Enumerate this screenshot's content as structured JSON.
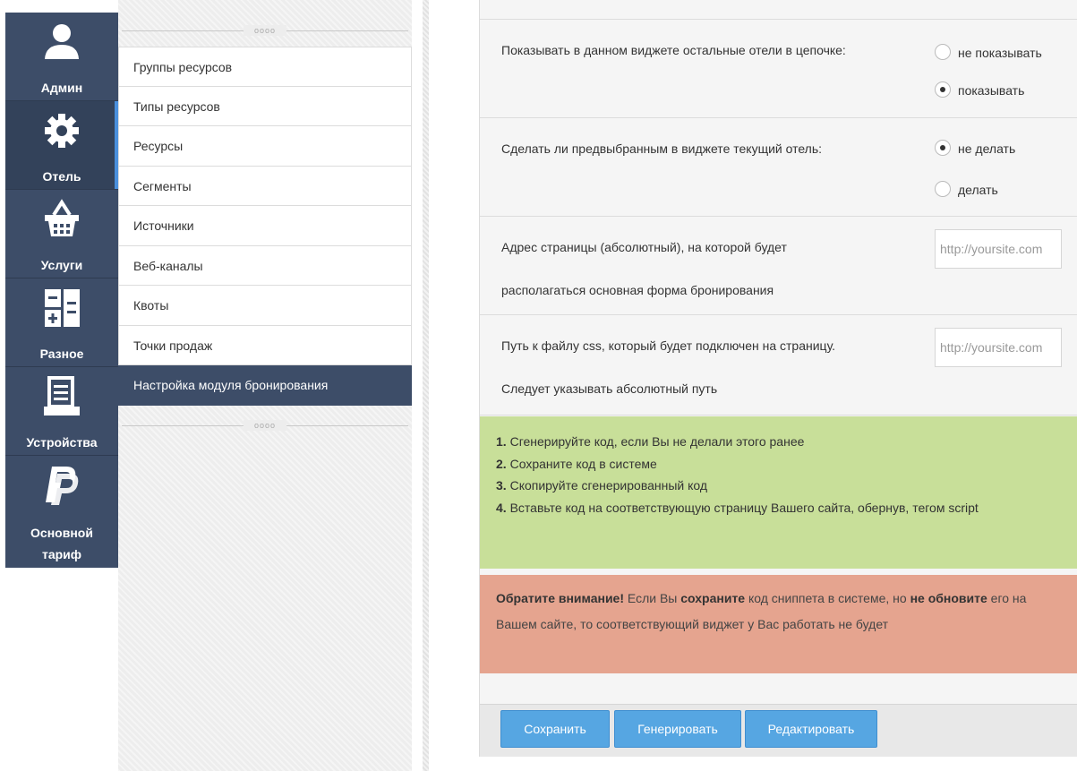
{
  "rail": {
    "items": [
      {
        "label": "Админ",
        "icon": "user-icon"
      },
      {
        "label": "Отель",
        "icon": "gear-icon",
        "active": true
      },
      {
        "label": "Услуги",
        "icon": "basket-icon"
      },
      {
        "label": "Разное",
        "icon": "calculator-icon"
      },
      {
        "label": "Устройства",
        "icon": "printer-icon"
      },
      {
        "label_line1": "Основной",
        "label_line2": "тариф",
        "icon": "paypal-icon"
      }
    ]
  },
  "submenu": {
    "grip_dots": "oooo",
    "items": [
      {
        "label": "Группы ресурсов"
      },
      {
        "label": "Типы ресурсов"
      },
      {
        "label": "Ресурсы"
      },
      {
        "label": "Сегменты"
      },
      {
        "label": "Источники"
      },
      {
        "label": "Веб-каналы"
      },
      {
        "label": "Квоты"
      },
      {
        "label": "Точки продаж"
      },
      {
        "label": "Настройка модуля бронирования",
        "active": true
      }
    ]
  },
  "form": {
    "show_chain": {
      "label": "Показывать в данном виджете остальные отели в цепочке:",
      "options": [
        "не показывать",
        "показывать"
      ],
      "selected": "показывать"
    },
    "preselect": {
      "label": "Сделать ли предвыбранным в виджете текущий отель:",
      "options": [
        "не делать",
        "делать"
      ],
      "selected": "не делать"
    },
    "page_address": {
      "label_line1": "Адрес страницы (абсолютный), на которой будет",
      "label_line2": "располагаться основная форма бронирования",
      "placeholder": "http://yoursite.com"
    },
    "css_path": {
      "label_line1": "Путь к файлу css, который будет подключен на страницу.",
      "label_line2": "Следует указывать абсолютный путь",
      "placeholder": "http://yoursite.com"
    }
  },
  "instructions": {
    "steps": [
      {
        "num": "1.",
        "text": " Сгенерируйте код, если Вы не делали этого ранее"
      },
      {
        "num": "2.",
        "text": " Сохраните код в системе"
      },
      {
        "num": "3.",
        "text": " Скопируйте сгенерированный код"
      },
      {
        "num": "4.",
        "text": " Вставьте код на соответствующую страницу Вашего сайта, обернув, тегом script"
      }
    ]
  },
  "warning": {
    "bold1": "Обратите внимание!",
    "text1": " Если Вы ",
    "bold2": "сохраните",
    "text2": " код сниппета в системе, но ",
    "bold3": "не обновите",
    "text3": " его на Вашем сайте, то соответствующий виджет у Вас работать не будет"
  },
  "buttons": {
    "save": "Сохранить",
    "generate": "Генерировать",
    "edit": "Редактировать"
  },
  "colors": {
    "rail": "#3d4d68",
    "accent": "#4a8fdc",
    "success": "#c8df99",
    "danger": "#e5a48f",
    "button": "#56a6e2"
  }
}
